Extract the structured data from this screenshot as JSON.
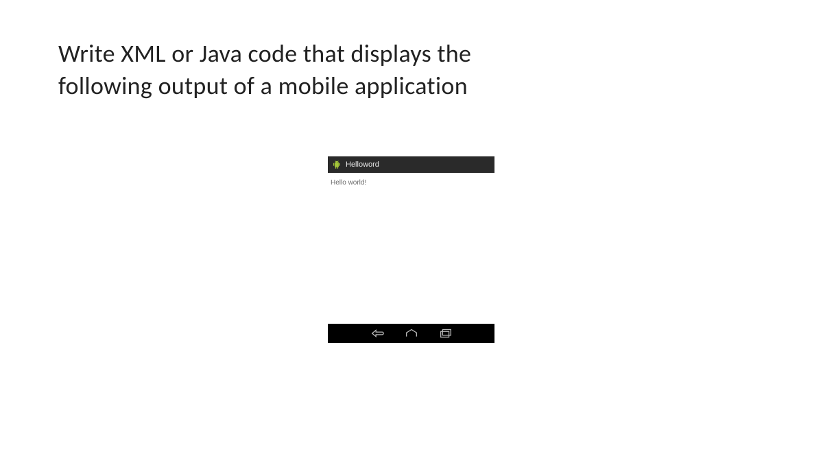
{
  "question": {
    "line1": "Write XML or Java code that displays the",
    "line2": "following output of a mobile application"
  },
  "device": {
    "appTitle": "Helloword",
    "bodyText": "Hello world!",
    "nav": {
      "back": "back-icon",
      "home": "home-icon",
      "recents": "recents-icon"
    },
    "colors": {
      "frame": "#000000",
      "actionBar": "#2a2a2a",
      "androidGreen": "#a4c639"
    }
  }
}
